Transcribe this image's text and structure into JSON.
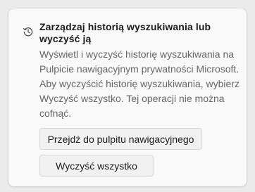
{
  "section": {
    "icon": "history-icon",
    "title": "Zarządzaj historią wyszukiwania lub wyczyść ją",
    "description": "Wyświetl i wyczyść historię wyszukiwania na Pulpicie nawigacyjnym prywatności Microsoft. Aby wyczyścić historię wyszukiwania, wybierz Wyczyść wszystko. Tej operacji nie można cofnąć.",
    "buttons": {
      "dashboard_label": "Przejdź do pulpitu nawigacyjnego",
      "clear_all_label": "Wyczyść wszystko"
    }
  },
  "colors": {
    "background": "#ebebeb",
    "card": "#f9f9f9",
    "title_text": "#1b1b1b",
    "body_text": "#666666",
    "button_bg": "#f1f1f1",
    "button_border": "#d6d6d6"
  }
}
